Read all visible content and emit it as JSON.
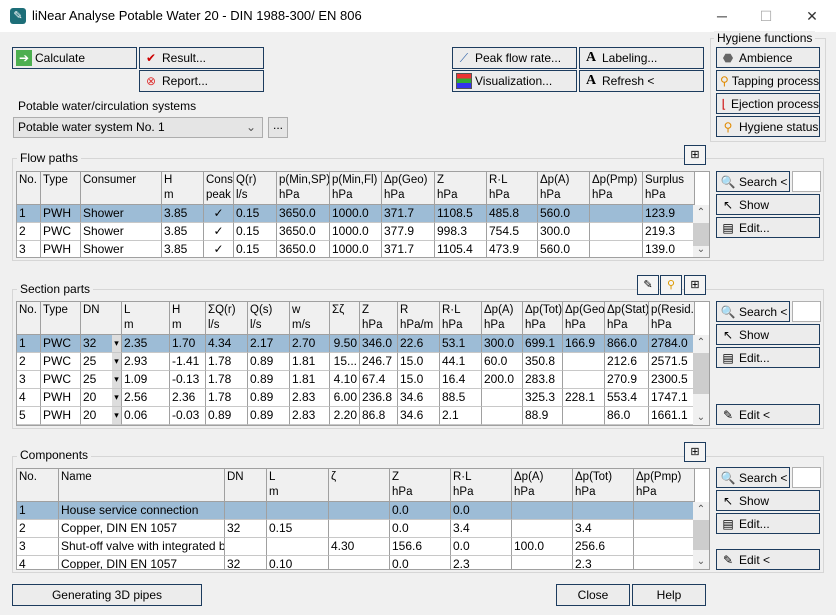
{
  "window": {
    "title": "liNear Analyse Potable Water 20 - DIN 1988-300/ EN 806",
    "minimize": "─",
    "maximize": "☐",
    "close": "✕"
  },
  "toolbar": {
    "calculate": "Calculate",
    "result": "Result...",
    "report": "Report...",
    "peak_flow": "Peak flow rate...",
    "labeling": "Labeling...",
    "visualization": "Visualization...",
    "refresh": "Refresh <"
  },
  "hygiene": {
    "title": "Hygiene functions",
    "ambience": "Ambience",
    "tapping": "Tapping process",
    "ejection": "Ejection process",
    "status": "Hygiene status"
  },
  "systems": {
    "label": "Potable water/circulation systems",
    "selected": "Potable water system No. 1",
    "more": "..."
  },
  "side": {
    "search": "Search <",
    "show": "Show",
    "edit": "Edit...",
    "edit_lt": "Edit <"
  },
  "flow_paths": {
    "title": "Flow paths",
    "columns": [
      "No.",
      "Type",
      "Consumer",
      "H\nm",
      "Consi\npeak",
      "Q(r)\nl/s",
      "p(Min,SP)\nhPa",
      "p(Min,Fl)\nhPa",
      "Δp(Geo)\nhPa",
      "Z\nhPa",
      "R·L\nhPa",
      "Δp(A)\nhPa",
      "Δp(Pmp)\nhPa",
      "Surplus\nhPa"
    ],
    "rows": [
      [
        "1",
        "PWH",
        "Shower",
        "3.85",
        "✓",
        "0.15",
        "3650.0",
        "1000.0",
        "371.7",
        "1108.5",
        "485.8",
        "560.0",
        "",
        "123.9"
      ],
      [
        "2",
        "PWC",
        "Shower",
        "3.85",
        "✓",
        "0.15",
        "3650.0",
        "1000.0",
        "377.9",
        "998.3",
        "754.5",
        "300.0",
        "",
        "219.3"
      ],
      [
        "3",
        "PWH",
        "Shower",
        "3.85",
        "✓",
        "0.15",
        "3650.0",
        "1000.0",
        "371.7",
        "1105.4",
        "473.9",
        "560.0",
        "",
        "139.0"
      ]
    ],
    "selected_row": 0
  },
  "section_parts": {
    "title": "Section parts",
    "columns": [
      "No.",
      "Type",
      "DN",
      "L\nm",
      "H\nm",
      "ΣQ(r)\nl/s",
      "Q(s)\nl/s",
      "w\nm/s",
      "Σζ",
      "Z\nhPa",
      "R\nhPa/m",
      "R·L\nhPa",
      "Δp(A)\nhPa",
      "Δp(Tot)\nhPa",
      "Δp(Geo)\nhPa",
      "Δp(Stat)\nhPa",
      "p(Resid.)\nhPa"
    ],
    "rows": [
      [
        "1",
        "PWC",
        "32",
        "2.35",
        "1.70",
        "4.34",
        "2.17",
        "2.70",
        "9.50",
        "346.0",
        "22.6",
        "53.1",
        "300.0",
        "699.1",
        "166.9",
        "866.0",
        "2784.0"
      ],
      [
        "2",
        "PWC",
        "25",
        "2.93",
        "-1.41",
        "1.78",
        "0.89",
        "1.81",
        "15...",
        "246.7",
        "15.0",
        "44.1",
        "60.0",
        "350.8",
        "",
        "212.6",
        "2571.5"
      ],
      [
        "3",
        "PWC",
        "25",
        "1.09",
        "-0.13",
        "1.78",
        "0.89",
        "1.81",
        "4.10",
        "67.4",
        "15.0",
        "16.4",
        "200.0",
        "283.8",
        "",
        "270.9",
        "2300.5"
      ],
      [
        "4",
        "PWH",
        "20",
        "2.56",
        "2.36",
        "1.78",
        "0.89",
        "2.83",
        "6.00",
        "236.8",
        "34.6",
        "88.5",
        "",
        "325.3",
        "228.1",
        "553.4",
        "1747.1"
      ],
      [
        "5",
        "PWH",
        "20",
        "0.06",
        "-0.03",
        "0.89",
        "0.89",
        "2.83",
        "2.20",
        "86.8",
        "34.6",
        "2.1",
        "",
        "88.9",
        "",
        "86.0",
        "1661.1"
      ]
    ],
    "selected_row": 0
  },
  "components": {
    "title": "Components",
    "columns": [
      "No.",
      "Name",
      "DN",
      "L\nm",
      "ζ",
      "Z\nhPa",
      "R·L\nhPa",
      "Δp(A)\nhPa",
      "Δp(Tot)\nhPa",
      "Δp(Pmp)\nhPa"
    ],
    "rows": [
      [
        "1",
        "House service connection",
        "",
        "",
        "",
        "0.0",
        "0.0",
        "",
        "",
        ""
      ],
      [
        "2",
        "Copper, DIN EN 1057",
        "32",
        "0.15",
        "",
        "0.0",
        "3.4",
        "",
        "3.4",
        ""
      ],
      [
        "3",
        "Shut-off valve with integrated ba...",
        "",
        "",
        "4.30",
        "156.6",
        "0.0",
        "100.0",
        "256.6",
        ""
      ],
      [
        "4",
        "Copper, DIN EN 1057",
        "32",
        "0.10",
        "",
        "0.0",
        "2.3",
        "",
        "2.3",
        ""
      ]
    ],
    "selected_row": 0
  },
  "footer": {
    "generate": "Generating 3D pipes",
    "close": "Close",
    "help": "Help"
  },
  "colors": {
    "selection": "#9dbcd6",
    "button_border": "#1d3c5e"
  }
}
